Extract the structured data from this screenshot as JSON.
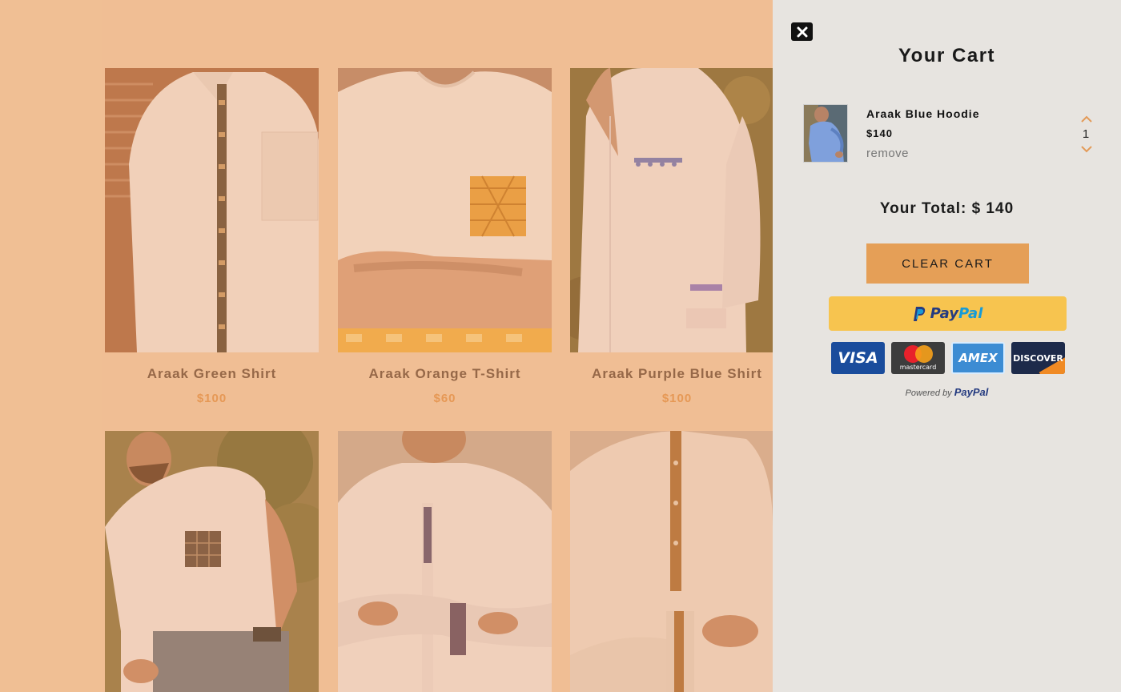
{
  "products": [
    {
      "name": "Araak Green Shirt",
      "price": "$100"
    },
    {
      "name": "Araak Orange T-Shirt",
      "price": "$60"
    },
    {
      "name": "Araak Purple Blue Shirt",
      "price": "$100"
    },
    {
      "name": "",
      "price": ""
    },
    {
      "name": "",
      "price": ""
    },
    {
      "name": "",
      "price": ""
    }
  ],
  "cart": {
    "title": "Your Cart",
    "close_icon": "close-icon",
    "items": [
      {
        "name": "Araak Blue Hoodie",
        "price": "$140",
        "remove_label": "remove",
        "quantity": "1"
      }
    ],
    "total_label": "Your Total: $ 140",
    "clear_label": "CLEAR CART",
    "paypal": {
      "brand_first": "Pay",
      "brand_second": "Pal",
      "cards": [
        "VISA",
        "mastercard",
        "AMEX",
        "DISCOVER"
      ],
      "powered_by": "Powered by",
      "powered_brand": "PayPal"
    }
  },
  "colors": {
    "page_bg": "#f2d2b4",
    "panel_bg": "#e7e4e0",
    "accent": "#e59f57",
    "paypal_yellow": "#f7c44f",
    "price": "#e39a58"
  }
}
